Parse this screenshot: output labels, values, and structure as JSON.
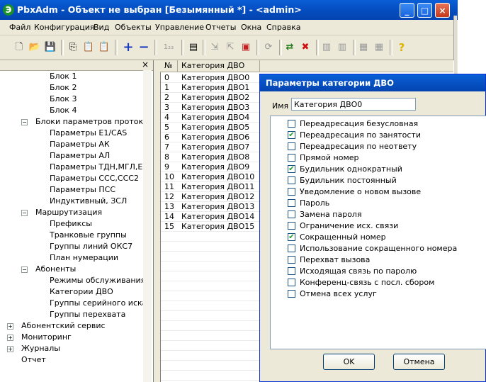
{
  "window": {
    "title": "PbxAdm - Объект не выбран [Безымянный *] - <admin>"
  },
  "title_buttons": {
    "minimize": "_",
    "maximize": "□",
    "close": "×"
  },
  "menu": [
    "Файл",
    "Конфигурация",
    "Вид",
    "Объекты",
    "Управление",
    "Отчеты",
    "Окна",
    "Справка"
  ],
  "tree": {
    "header_close": "×",
    "nodes": [
      {
        "label": "Блок 1"
      },
      {
        "label": "Блок 2"
      },
      {
        "label": "Блок 3"
      },
      {
        "label": "Блок 4"
      },
      {
        "label": "Блоки параметров протоколо",
        "toggle": "−"
      },
      {
        "label": "Параметры E1/CAS"
      },
      {
        "label": "Параметры АК"
      },
      {
        "label": "Параметры АЛ"
      },
      {
        "label": "Параметры ТДН,МГЛ,Е&"
      },
      {
        "label": "Параметры ССС,ССС2"
      },
      {
        "label": "Параметры ПСС"
      },
      {
        "label": "Индуктивный, ЗСЛ"
      },
      {
        "label": "Маршрутизация",
        "toggle": "−"
      },
      {
        "label": "Префиксы"
      },
      {
        "label": "Транковые группы"
      },
      {
        "label": "Группы линий ОКС7"
      },
      {
        "label": "План нумерации"
      },
      {
        "label": "Абоненты",
        "toggle": "−"
      },
      {
        "label": "Режимы обслуживания"
      },
      {
        "label": "Категории ДВО"
      },
      {
        "label": "Группы серийного искани"
      },
      {
        "label": "Группы перехвата"
      },
      {
        "label": "Абонентский сервис",
        "toggle": "+"
      },
      {
        "label": "Мониторинг",
        "toggle": "+"
      },
      {
        "label": "Журналы",
        "toggle": "+"
      },
      {
        "label": "Отчет"
      }
    ]
  },
  "list": {
    "columns": [
      "№",
      "Категория ДВО"
    ],
    "rows": [
      [
        "0",
        "Категория ДВО0"
      ],
      [
        "1",
        "Категория ДВО1"
      ],
      [
        "2",
        "Категория ДВО2"
      ],
      [
        "3",
        "Категория ДВО3"
      ],
      [
        "4",
        "Категория ДВО4"
      ],
      [
        "5",
        "Категория ДВО5"
      ],
      [
        "6",
        "Категория ДВО6"
      ],
      [
        "7",
        "Категория ДВО7"
      ],
      [
        "8",
        "Категория ДВО8"
      ],
      [
        "9",
        "Категория ДВО9"
      ],
      [
        "10",
        "Категория ДВО10"
      ],
      [
        "11",
        "Категория ДВО11"
      ],
      [
        "12",
        "Категория ДВО12"
      ],
      [
        "13",
        "Категория ДВО13"
      ],
      [
        "14",
        "Категория ДВО14"
      ],
      [
        "15",
        "Категория ДВО15"
      ]
    ]
  },
  "dialog": {
    "title": "Параметры категории ДВО",
    "name_label": "Имя",
    "name_value": "Категория ДВО0",
    "options": [
      {
        "label": "Переадресация безусловная",
        "checked": false
      },
      {
        "label": "Переадресация по занятости",
        "checked": true
      },
      {
        "label": "Переадресация по неответу",
        "checked": false
      },
      {
        "label": "Прямой номер",
        "checked": false
      },
      {
        "label": "Будильник однократный",
        "checked": true
      },
      {
        "label": "Будильник постоянный",
        "checked": false
      },
      {
        "label": "Уведомление о новом вызове",
        "checked": false
      },
      {
        "label": "Пароль",
        "checked": false
      },
      {
        "label": "Замена пароля",
        "checked": false
      },
      {
        "label": "Ограничение исх. связи",
        "checked": false
      },
      {
        "label": "Сокращенный номер",
        "checked": true
      },
      {
        "label": "Использование сокращенного номера",
        "checked": false
      },
      {
        "label": "Перехват вызова",
        "checked": false
      },
      {
        "label": "Исходящая связь по паролю",
        "checked": false
      },
      {
        "label": "Конференц-связь с посл. сбором",
        "checked": false
      },
      {
        "label": "Отмена всех услуг",
        "checked": false
      }
    ],
    "check_mark": "✔",
    "ok_label": "OK",
    "cancel_label": "Отмена"
  },
  "toolbar": {
    "icons": [
      "new-icon",
      "open-icon",
      "save-icon",
      "copy-icon",
      "paste-icon",
      "paste-special-icon",
      "add-icon",
      "remove-icon",
      "numbering-icon",
      "properties-icon",
      "export-icon",
      "import-icon",
      "config-icon",
      "refresh-icon",
      "connect-icon",
      "stop-icon",
      "doc1-icon",
      "doc2-icon",
      "doc3-icon",
      "doc4-icon",
      "help-icon"
    ],
    "glyphs": {
      "new": "🗋",
      "open": "📂",
      "save": "💾",
      "copy": "⎘",
      "paste": "📋",
      "paste2": "📋",
      "add": "+",
      "remove": "−",
      "numbering": "1₂₃",
      "properties": "▤",
      "export": "⇲",
      "import": "⇱",
      "config": "▣",
      "refresh": "⟳",
      "connect": "⇄",
      "stop": "✖",
      "doc1": "▥",
      "doc2": "▥",
      "doc3": "▦",
      "doc4": "▦",
      "help": "?"
    }
  }
}
